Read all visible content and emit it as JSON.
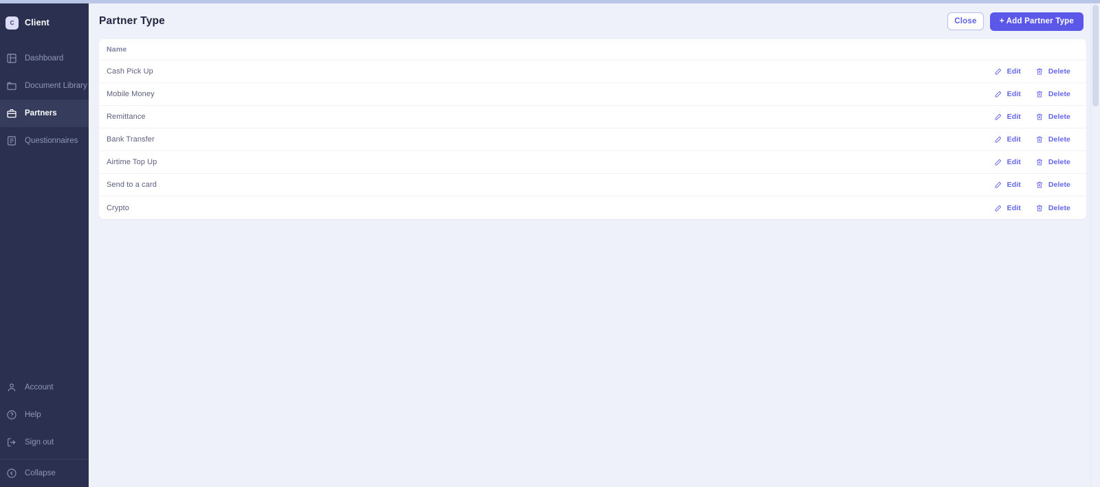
{
  "brand": {
    "badge_letter": "C",
    "name": "Client"
  },
  "sidebar": {
    "items": [
      {
        "label": "Dashboard",
        "icon": "layout-dashboard-icon",
        "active": false
      },
      {
        "label": "Document Library",
        "icon": "folder-icon",
        "active": false
      },
      {
        "label": "Partners",
        "icon": "briefcase-icon",
        "active": true
      },
      {
        "label": "Questionnaires",
        "icon": "clipboard-list-icon",
        "active": false
      }
    ],
    "bottom_items": [
      {
        "label": "Account",
        "icon": "user-icon"
      },
      {
        "label": "Help",
        "icon": "question-circle-icon"
      },
      {
        "label": "Sign out",
        "icon": "sign-out-icon"
      },
      {
        "label": "Collapse",
        "icon": "chevron-left-circle-icon"
      }
    ]
  },
  "header": {
    "title": "Partner Type",
    "close_label": "Close",
    "add_label": "+ Add Partner Type"
  },
  "table": {
    "columns": [
      "Name"
    ],
    "edit_label": "Edit",
    "delete_label": "Delete",
    "rows": [
      {
        "name": "Cash Pick Up"
      },
      {
        "name": "Mobile Money"
      },
      {
        "name": "Remittance"
      },
      {
        "name": "Bank Transfer"
      },
      {
        "name": "Airtime Top Up"
      },
      {
        "name": "Send to a card"
      },
      {
        "name": "Crypto"
      }
    ]
  },
  "colors": {
    "sidebar_bg": "#2b3050",
    "sidebar_active_bg": "#363c5c",
    "page_bg": "#eef1fa",
    "accent": "#5b57e8",
    "action_link": "#6366e8",
    "top_strip": "#b9c6e8"
  }
}
